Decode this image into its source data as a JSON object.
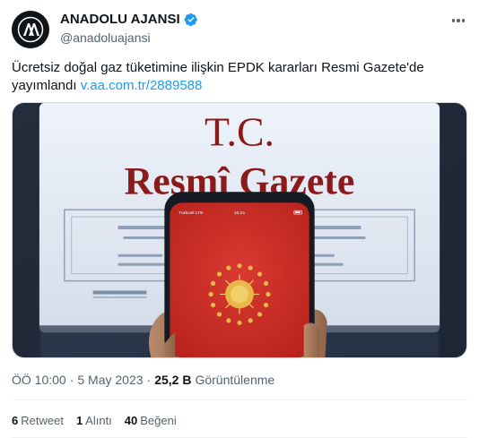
{
  "author": {
    "display_name": "ANADOLU AJANSI",
    "handle": "@anadoluajansi",
    "verified": true,
    "avatar_icon": "aa-logo-icon"
  },
  "tweet": {
    "text": "Ücretsiz doğal gaz tüketimine ilişkin EPDK kararları Resmi Gazete'de yayımlandı ",
    "link_text": "v.aa.com.tr/2889588"
  },
  "media": {
    "screen_line1": "T.C.",
    "screen_line2": "Resmî Gazete",
    "phone_status_left": "Turkcell LTE",
    "phone_status_time": "10:21",
    "description_icon": "presidential-seal-icon"
  },
  "meta": {
    "time": "ÖÖ 10:00",
    "separator": "·",
    "date": "5 May 2023",
    "separator2": "·",
    "views_count": "25,2 B",
    "views_label": "Görüntülenme"
  },
  "stats": {
    "retweets_count": "6",
    "retweets_label": "Retweet",
    "quotes_count": "1",
    "quotes_label": "Alıntı",
    "likes_count": "40",
    "likes_label": "Beğeni"
  },
  "colors": {
    "link": "#1d9bf0",
    "verified": "#1d9bf0",
    "secondary_text": "#536471",
    "phone_screen_red": "#d0302a",
    "gazette_red": "#8b1a1a"
  }
}
